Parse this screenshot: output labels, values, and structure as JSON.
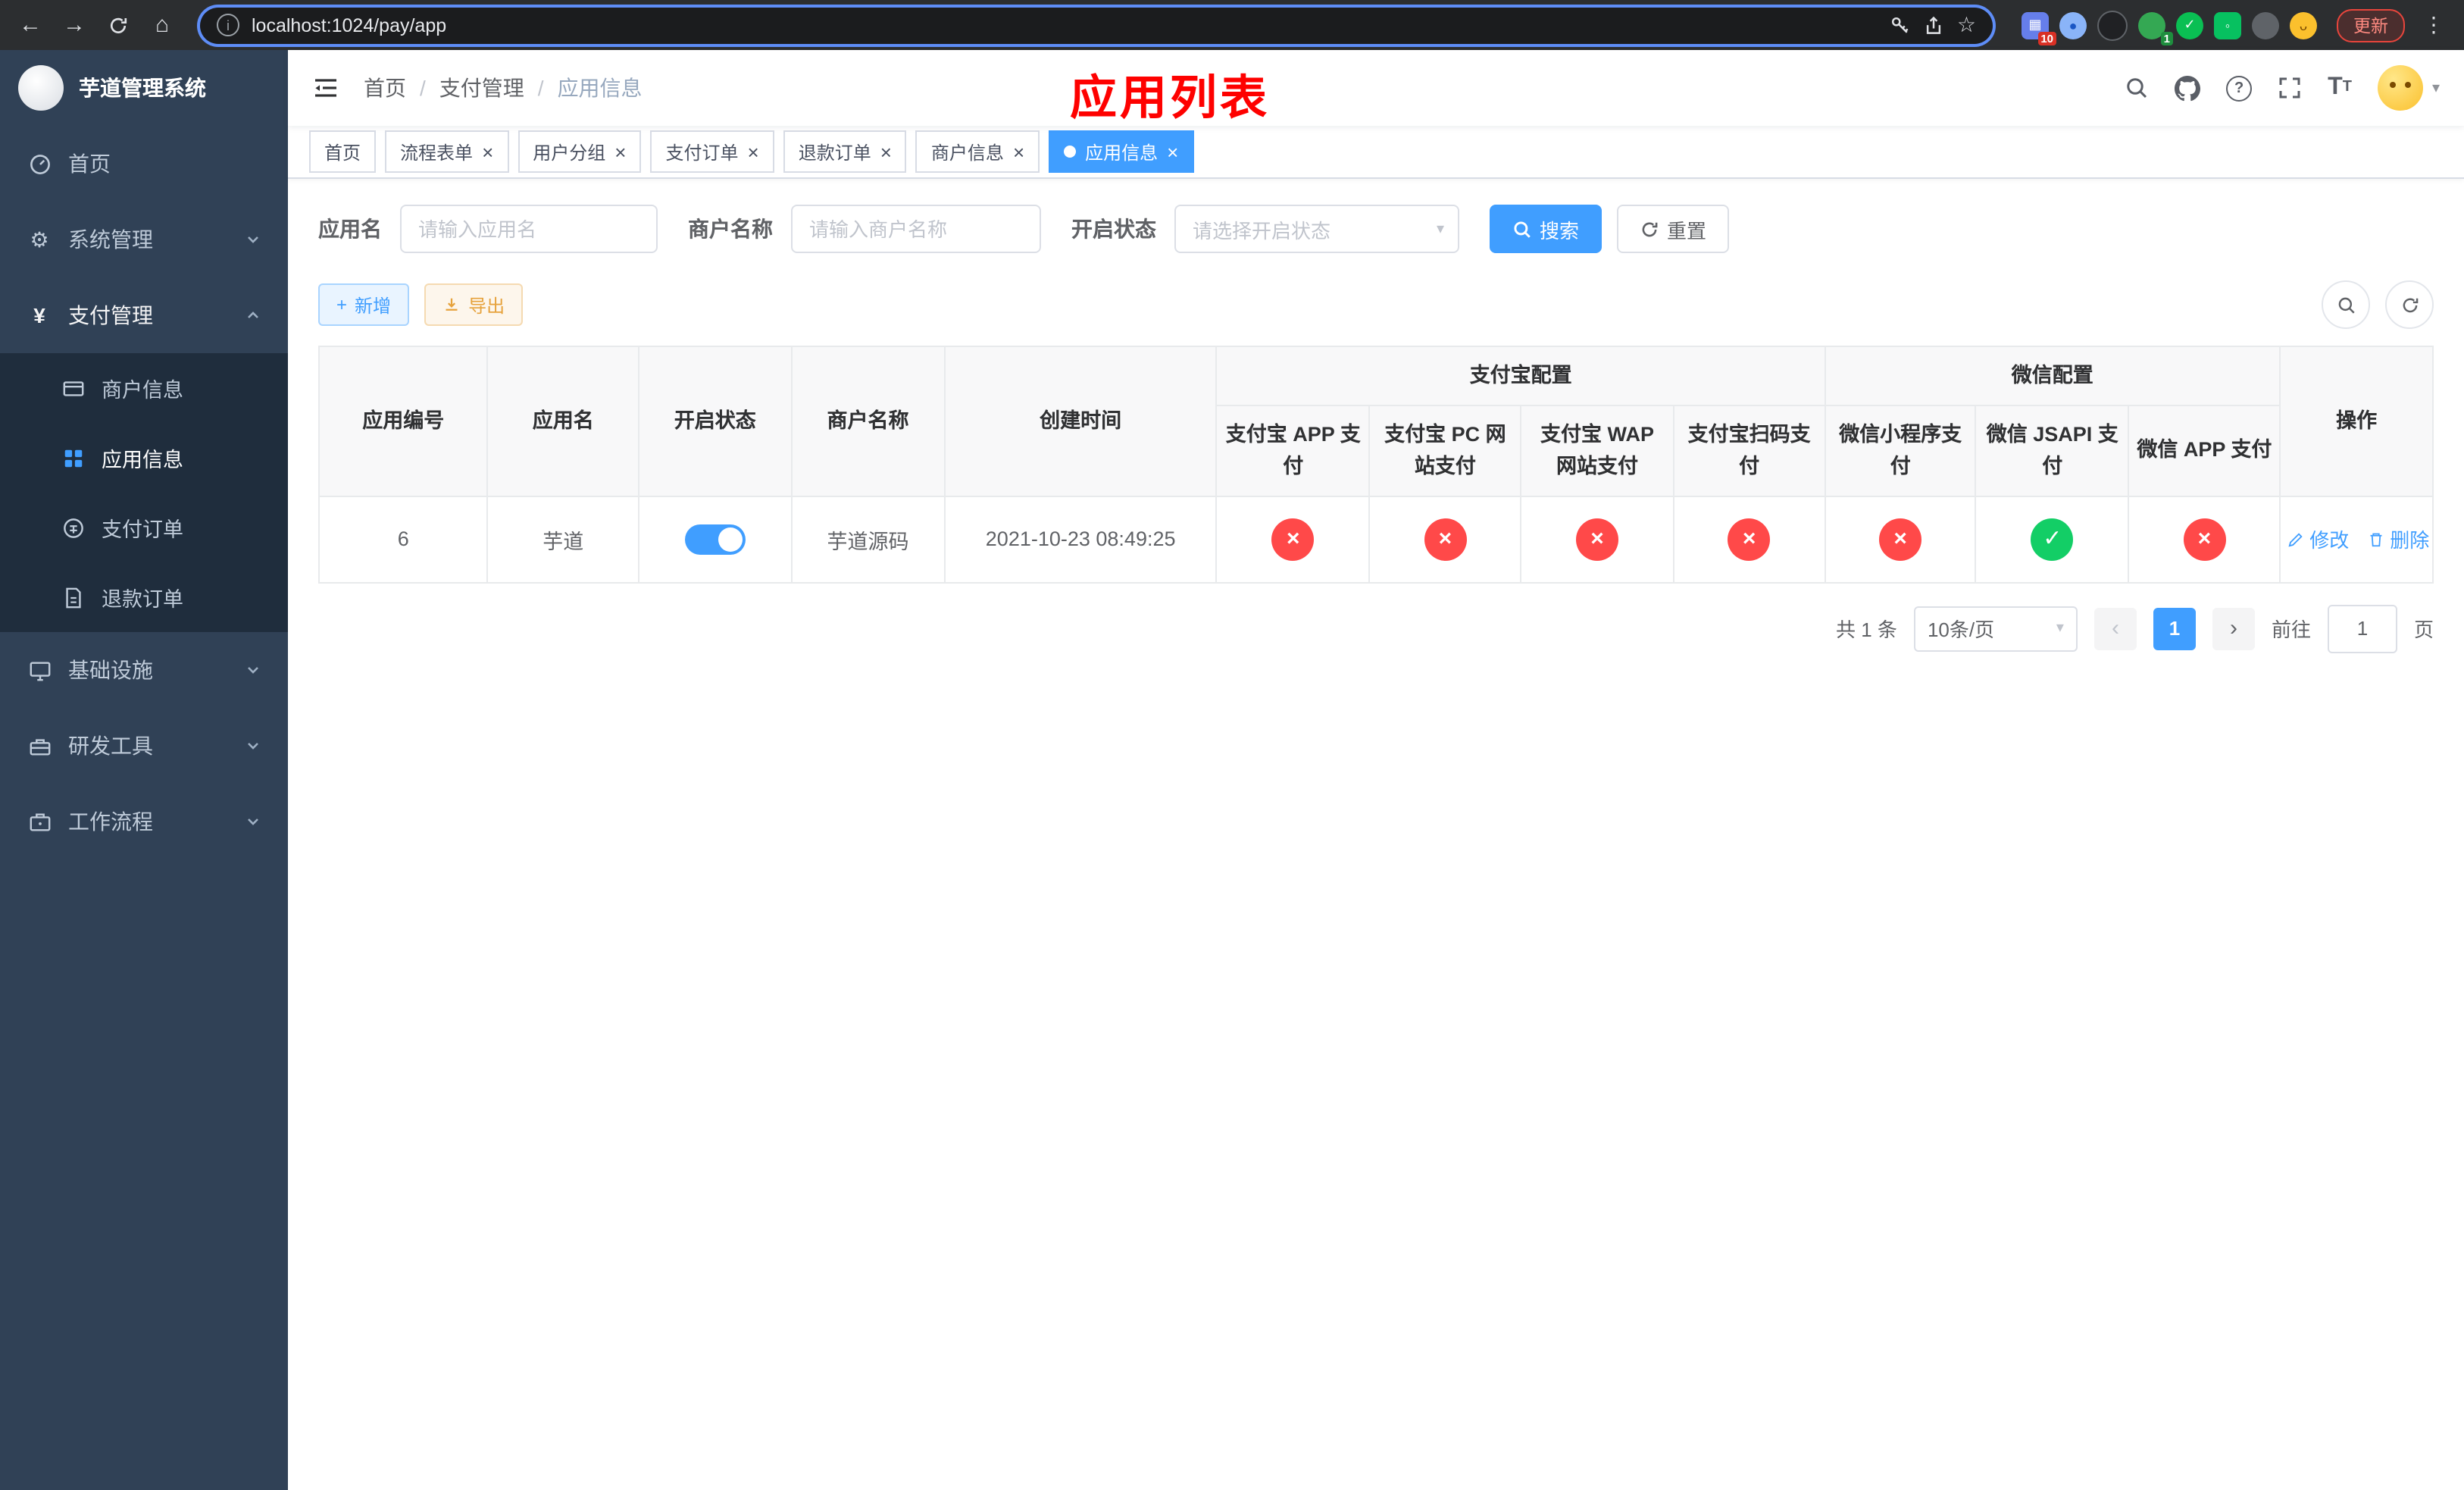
{
  "browser": {
    "url": "localhost:1024/pay/app",
    "update_label": "更新",
    "ext_badges": {
      "first": "10",
      "second": "1"
    }
  },
  "sidebar": {
    "title": "芋道管理系统",
    "items": [
      {
        "label": "首页"
      },
      {
        "label": "系统管理"
      },
      {
        "label": "支付管理",
        "children": [
          {
            "label": "商户信息"
          },
          {
            "label": "应用信息"
          },
          {
            "label": "支付订单"
          },
          {
            "label": "退款订单"
          }
        ]
      },
      {
        "label": "基础设施"
      },
      {
        "label": "研发工具"
      },
      {
        "label": "工作流程"
      }
    ]
  },
  "header": {
    "breadcrumb": [
      "首页",
      "支付管理",
      "应用信息"
    ],
    "annotation": "应用列表"
  },
  "tabs": [
    {
      "label": "首页"
    },
    {
      "label": "流程表单"
    },
    {
      "label": "用户分组"
    },
    {
      "label": "支付订单"
    },
    {
      "label": "退款订单"
    },
    {
      "label": "商户信息"
    },
    {
      "label": "应用信息"
    }
  ],
  "filters": {
    "app_name_label": "应用名",
    "app_name_placeholder": "请输入应用名",
    "merchant_label": "商户名称",
    "merchant_placeholder": "请输入商户名称",
    "status_label": "开启状态",
    "status_placeholder": "请选择开启状态",
    "search_label": "搜索",
    "reset_label": "重置"
  },
  "toolbar": {
    "add_label": "新增",
    "export_label": "导出"
  },
  "table": {
    "columns": {
      "id": "应用编号",
      "name": "应用名",
      "status": "开启状态",
      "merchant": "商户名称",
      "created": "创建时间",
      "action": "操作"
    },
    "alipay_group": {
      "label": "支付宝配置",
      "cols": [
        "支付宝 APP 支付",
        "支付宝 PC 网站支付",
        "支付宝 WAP 网站支付",
        "支付宝扫码支付"
      ]
    },
    "wechat_group": {
      "label": "微信配置",
      "cols": [
        "微信小程序支付",
        "微信 JSAPI 支付",
        "微信 APP 支付"
      ]
    },
    "row": {
      "id": "6",
      "name": "芋道",
      "enabled": true,
      "merchant": "芋道源码",
      "created": "2021-10-23 08:49:25",
      "alipay_app": false,
      "alipay_pc": false,
      "alipay_wap": false,
      "alipay_qr": false,
      "wechat_lite": false,
      "wechat_jsapi": true,
      "wechat_app": false,
      "edit_label": "修改",
      "delete_label": "删除"
    }
  },
  "pagination": {
    "total": "共 1 条",
    "page_size": "10条/页",
    "current_page": "1",
    "goto_label": "前往",
    "goto_value": "1",
    "goto_suffix": "页"
  },
  "colors": {
    "accent": "#409EFF",
    "success": "#13ce66",
    "danger": "#ff4949",
    "sidebar_bg": "#304156",
    "submenu_bg": "#1f2d3d",
    "annotation": "#ff0000"
  }
}
